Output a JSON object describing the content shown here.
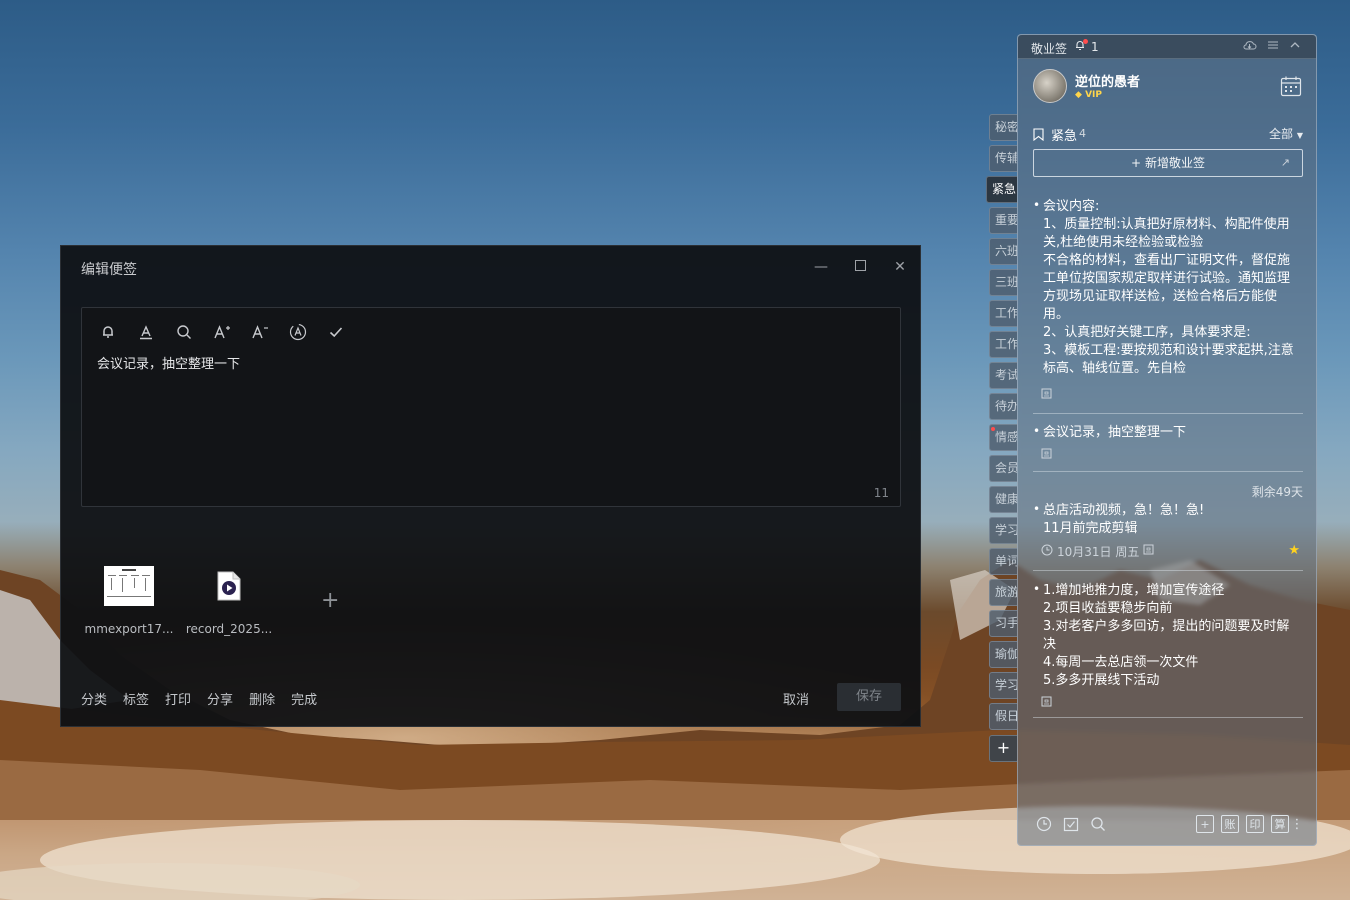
{
  "editor": {
    "title": "编辑便签",
    "minimize_icon": "minimize-icon",
    "maximize_icon": "maximize-icon",
    "close_icon": "close-icon",
    "toolbar_icons": [
      "bell-icon",
      "font-color-icon",
      "search-icon",
      "font-larger-icon",
      "font-smaller-icon",
      "auto-format-icon",
      "check-icon"
    ],
    "content": "会议记录，抽空整理一下",
    "char_count": "11",
    "attachments": [
      {
        "name": "mmexport17...",
        "icon": "image-thumbnail"
      },
      {
        "name": "record_2025...",
        "icon": "video-file-icon"
      }
    ],
    "links": [
      "分类",
      "标签",
      "打印",
      "分享",
      "删除",
      "完成"
    ],
    "cancel_label": "取消",
    "save_label": "保存"
  },
  "tabs": {
    "items": [
      "秘密",
      "传辅",
      "紧急",
      "重要",
      "六班",
      "三班",
      "工作",
      "工作",
      "考试",
      "待办",
      "情感",
      "会员",
      "健康",
      "学习",
      "单词",
      "旅游",
      "习手",
      "瑜伽",
      "学习",
      "假日"
    ],
    "active": "紧急"
  },
  "panel": {
    "app_name": "敬业签",
    "bell_count": "1",
    "username": "逆位的愚者",
    "vip_label": "VIP",
    "category": "紧急",
    "category_count": "4",
    "filter_label": "全部",
    "new_button_label": "新增敬业签",
    "notes": [
      {
        "lines": [
          "会议内容:",
          "1、质量控制:认真把好原材料、构配件使用",
          "关,杜绝使用未经检验或检验",
          "不合格的材料，查看出厂证明文件，督促施",
          "工单位按国家规定取样进行试验。通知监理",
          "方现场见证取样送检，送检合格后方能使",
          "用。",
          "2、认真把好关键工序，具体要求是:",
          "3、模板工程:要按规范和设计要求起拱,注意",
          "标高、轴线位置。先自检"
        ]
      },
      {
        "lines": [
          "会议记录，抽空整理一下"
        ]
      },
      {
        "remaining": "剩余49天",
        "lines": [
          "总店活动视频，急！急！急!",
          "11月前完成剪辑"
        ],
        "date": "10月31日 周五"
      },
      {
        "lines": [
          "1.增加地推力度，增加宣传途径",
          "2.项目收益要稳步向前",
          "3.对老客户多多回访，提出的问题要及时解",
          "决",
          "4.每周一去总店领一次文件",
          "5.多多开展线下活动"
        ]
      }
    ],
    "footer_boxes": [
      "账",
      "印",
      "算"
    ]
  }
}
